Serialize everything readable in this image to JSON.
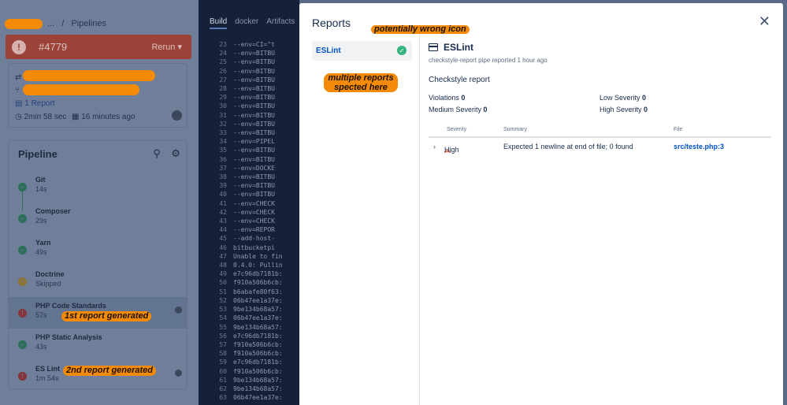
{
  "breadcrumb": {
    "ellipsis": "...",
    "separator": "/",
    "current": "Pipelines"
  },
  "build": {
    "number": "#4779",
    "rerun_label": "Rerun"
  },
  "info": {
    "reports_link": "1 Report",
    "duration": "2min 58 sec",
    "time_ago": "16 minutes ago"
  },
  "pipeline": {
    "title": "Pipeline",
    "steps": [
      {
        "name": "Git",
        "duration": "14s",
        "status": "success"
      },
      {
        "name": "Composer",
        "duration": "29s",
        "status": "success"
      },
      {
        "name": "Yarn",
        "duration": "49s",
        "status": "success"
      },
      {
        "name": "Doctrine",
        "duration": "Skipped",
        "status": "skipped"
      },
      {
        "name": "PHP Code Standards",
        "duration": "57s",
        "status": "failed"
      },
      {
        "name": "PHP Static Analysis",
        "duration": "43s",
        "status": "success"
      },
      {
        "name": "ES Lint",
        "duration": "1m 54s",
        "status": "failed"
      }
    ]
  },
  "annotations": {
    "first_report": "1st report generated",
    "second_report": "2nd report generated",
    "wrong_icon": "potentially wrong icon",
    "multiple_reports": "multiple reports spected here"
  },
  "log": {
    "tabs": [
      "Build",
      "docker",
      "Artifacts"
    ],
    "lines": [
      {
        "n": "23",
        "t": "  --env=CI=\"t"
      },
      {
        "n": "24",
        "t": "  --env=BITBU"
      },
      {
        "n": "25",
        "t": "  --env=BITBU"
      },
      {
        "n": "26",
        "t": "  --env=BITBU"
      },
      {
        "n": "27",
        "t": "  --env=BITBU"
      },
      {
        "n": "28",
        "t": "  --env=BITBU"
      },
      {
        "n": "29",
        "t": "  --env=BITBU"
      },
      {
        "n": "30",
        "t": "  --env=BITBU"
      },
      {
        "n": "31",
        "t": "  --env=BITBU"
      },
      {
        "n": "32",
        "t": "  --env=BITBU"
      },
      {
        "n": "33",
        "t": "  --env=BITBU"
      },
      {
        "n": "34",
        "t": "  --env=PIPEL"
      },
      {
        "n": "35",
        "t": "  --env=BITBU"
      },
      {
        "n": "36",
        "t": "  --env=BITBU"
      },
      {
        "n": "37",
        "t": "  --env=DOCKE"
      },
      {
        "n": "38",
        "t": "  --env=BITBU"
      },
      {
        "n": "39",
        "t": "  --env=BITBU"
      },
      {
        "n": "40",
        "t": "  --env=BITBU"
      },
      {
        "n": "41",
        "t": "  --env=CHECK"
      },
      {
        "n": "42",
        "t": "  --env=CHECK"
      },
      {
        "n": "43",
        "t": "  --env=CHECK"
      },
      {
        "n": "44",
        "t": "  --env=REPOR"
      },
      {
        "n": "45",
        "t": "  --add-host-"
      },
      {
        "n": "46",
        "t": " bitbucketpi"
      },
      {
        "n": "47",
        "t": "Unable to fin"
      },
      {
        "n": "48",
        "t": "0.4.0: Pullin"
      },
      {
        "n": "49",
        "t": "e7c96db7181b:"
      },
      {
        "n": "50",
        "t": "f910a506b6cb:"
      },
      {
        "n": "51",
        "t": "b6abafe80f63:"
      },
      {
        "n": "52",
        "t": "06b47ee1a37e:"
      },
      {
        "n": "53",
        "t": "9be134b68a57:"
      },
      {
        "n": "54",
        "t": "06b47ee1a37e:"
      },
      {
        "n": "55",
        "t": "9be134b68a57:"
      },
      {
        "n": "56",
        "t": "e7c96db7181b:"
      },
      {
        "n": "57",
        "t": "f910a506b6cb:"
      },
      {
        "n": "58",
        "t": "f910a506b6cb:"
      },
      {
        "n": "59",
        "t": "e7c96db7181b:"
      },
      {
        "n": "60",
        "t": "f910a506b6cb:"
      },
      {
        "n": "61",
        "t": "9be134b68a57:"
      },
      {
        "n": "62",
        "t": "9be134b68a57:"
      },
      {
        "n": "63",
        "t": "06b47ee1a37e:"
      }
    ]
  },
  "modal": {
    "title": "Reports",
    "close_icon": "close-icon",
    "report_list": [
      {
        "label": "ESLint",
        "status": "success"
      }
    ],
    "report": {
      "name": "ESLint",
      "subtitle": "checkstyle-report pipe reported 1 hour ago",
      "description": "Checkstyle report",
      "metrics": {
        "violations_label": "Violations",
        "violations": "0",
        "low_label": "Low Severity",
        "low": "0",
        "medium_label": "Medium Severity",
        "medium": "0",
        "high_label": "High Severity",
        "high": "0"
      },
      "table": {
        "headers": {
          "severity": "Severity",
          "summary": "Summary",
          "file": "File"
        },
        "rows": [
          {
            "severity": "High",
            "summary": "Expected 1 newline at end of file; 0 found",
            "file": "src/teste.php:3"
          }
        ]
      }
    }
  },
  "colors": {
    "accent": "#0052cc",
    "success": "#36b37e",
    "failure": "#de350b",
    "annotation": "#f58a07"
  }
}
